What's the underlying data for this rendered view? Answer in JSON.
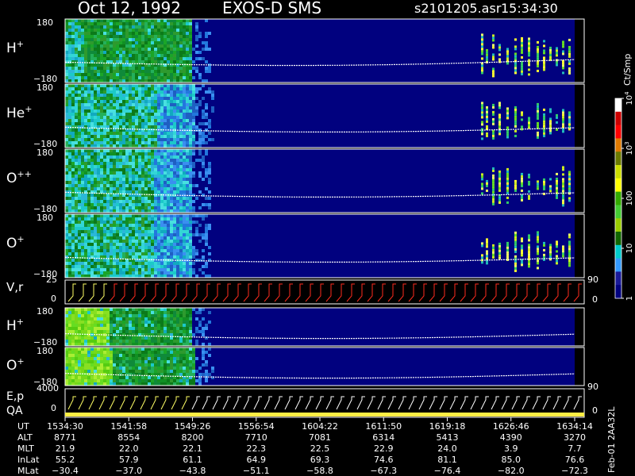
{
  "header": {
    "date": "Oct 12, 1992",
    "instrument": "EXOS-D SMS",
    "file": "s2101205.asr",
    "time": "15:34:30"
  },
  "colors": {
    "background": "#01017f",
    "trace": "#ffffff",
    "vr_marks": "#ff2b1e"
  },
  "chart_data": {
    "type": "heatmap",
    "panels": [
      {
        "id": "h-plus",
        "label": "H",
        "sup": "+",
        "ytick_top": "180",
        "ytick_bottom": "−180",
        "ylim": [
          -180,
          180
        ],
        "activity_end": 240,
        "profile": "front"
      },
      {
        "id": "he-plus",
        "label": "He",
        "sup": "+",
        "ytick_top": "180",
        "ytick_bottom": "−180",
        "ylim": [
          -180,
          180
        ],
        "activity_end": 245,
        "profile": "fade"
      },
      {
        "id": "o-pp",
        "label": "O",
        "sup": "++",
        "ytick_top": "180",
        "ytick_bottom": "−180",
        "ylim": [
          -180,
          180
        ],
        "activity_end": 240,
        "profile": "fade"
      },
      {
        "id": "o-plus",
        "label": "O",
        "sup": "+",
        "ytick_top": "180",
        "ytick_bottom": "−180",
        "ylim": [
          -180,
          180
        ],
        "activity_end": 240,
        "profile": "fade"
      },
      {
        "id": "h-plus-2",
        "label": "H",
        "sup": "+",
        "ytick_top": "180",
        "ytick_bottom": "−180",
        "ylim": [
          -180,
          180
        ],
        "activity_end": 240,
        "profile": "bright"
      },
      {
        "id": "o-plus-2",
        "label": "O",
        "sup": "+",
        "ytick_top": "180",
        "ytick_bottom": "−180",
        "ylim": [
          -180,
          180
        ],
        "activity_end": 245,
        "profile": "bright"
      }
    ],
    "vr_panel": {
      "label": "V,r",
      "ytick_top": "25",
      "ytick_bottom": "0",
      "right_top": "90",
      "right_bottom": "0"
    },
    "ep_panel": {
      "label1": "E,p",
      "label2": "QA",
      "ytick_top": "4000",
      "ytick_bottom": "0",
      "right_top": "90",
      "right_bottom": "0"
    },
    "colorbar": {
      "unit": "Ct/Smp",
      "scale": "log",
      "range": [
        1,
        10000
      ],
      "tick_labels": [
        "10",
        "10",
        "100",
        "10",
        "1"
      ],
      "tick_sups": [
        "4",
        "3",
        "",
        "",
        ""
      ],
      "tick_values": [
        10000,
        1000,
        100,
        10,
        1
      ],
      "colors": [
        "#ffffff",
        "#cc0000",
        "#ff0000",
        "#e07a00",
        "#6b7a00",
        "#ccdd00",
        "#ffff00",
        "#33aa00",
        "#44cc33",
        "#99cc00",
        "#116600",
        "#00cccc",
        "#3399ff",
        "#1a1a99",
        "#01017f"
      ]
    },
    "x_axis": {
      "row_labels": [
        "UT",
        "ALT",
        "MLT",
        "InLat",
        "MLat"
      ],
      "columns": [
        {
          "UT": "1534:30",
          "ALT": "8771",
          "MLT": "21.9",
          "InLat": "55.2",
          "MLat": "−30.4"
        },
        {
          "UT": "1541:58",
          "ALT": "8554",
          "MLT": "22.0",
          "InLat": "57.9",
          "MLat": "−37.0"
        },
        {
          "UT": "1549:26",
          "ALT": "8200",
          "MLT": "22.1",
          "InLat": "61.1",
          "MLat": "−43.8"
        },
        {
          "UT": "1556:54",
          "ALT": "7710",
          "MLT": "22.3",
          "InLat": "64.9",
          "MLat": "−51.1"
        },
        {
          "UT": "1604:22",
          "ALT": "7081",
          "MLT": "22.5",
          "InLat": "69.3",
          "MLat": "−58.8"
        },
        {
          "UT": "1611:50",
          "ALT": "6314",
          "MLT": "22.9",
          "InLat": "74.6",
          "MLat": "−67.3"
        },
        {
          "UT": "1619:18",
          "ALT": "5413",
          "MLT": "24.0",
          "InLat": "81.1",
          "MLat": "−76.4"
        },
        {
          "UT": "1626:46",
          "ALT": "4390",
          "MLT": "3.9",
          "InLat": "85.0",
          "MLat": "−82.0"
        },
        {
          "UT": "1634:14",
          "ALT": "3270",
          "MLT": "7.7",
          "InLat": "76.6",
          "MLat": "−72.3"
        }
      ]
    },
    "footer_vertical": "Feb-01 2AA32L"
  }
}
